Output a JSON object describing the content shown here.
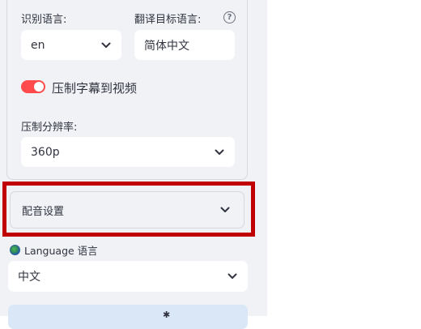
{
  "recognition": {
    "label": "识别语言:",
    "value": "en"
  },
  "translation": {
    "label": "翻译目标语言:",
    "value": "简体中文",
    "help_icon": "?"
  },
  "burn_subtitles": {
    "label": "压制字幕到视频",
    "enabled": true,
    "accent_color": "#ff4b4b"
  },
  "resolution": {
    "label": "压制分辨率:",
    "value": "360p"
  },
  "dubbing": {
    "label": "配音设置",
    "highlight_color": "#c00000"
  },
  "language": {
    "label": "Language 语言",
    "value": "中文"
  },
  "bottom_button": {
    "glyph": "✱"
  }
}
